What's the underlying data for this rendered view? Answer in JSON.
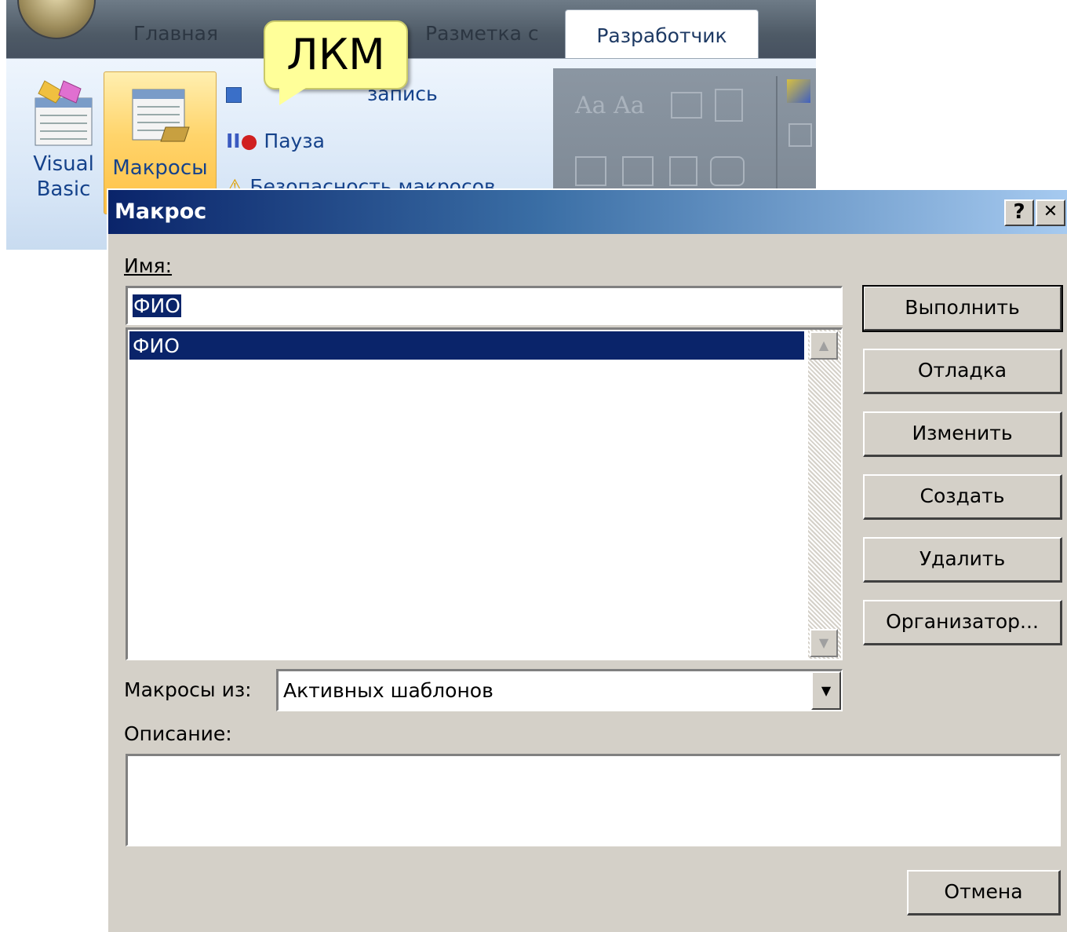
{
  "ribbon": {
    "tabs": [
      "Главная",
      "Разметка с"
    ],
    "active_tab": "Разработчик",
    "visual_basic": [
      "Visual",
      "Basic"
    ],
    "macros_label": "Макросы",
    "items": [
      "запись",
      "Пауза",
      "Безопасность макросов"
    ],
    "disabled_group_text": "Aa Aa"
  },
  "callout": {
    "text": "ЛКМ"
  },
  "dialog": {
    "title": "Макрос",
    "help_btn": "?",
    "close_btn": "✕",
    "name_label": "Имя:",
    "name_value": "ФИО",
    "list_items": [
      "ФИО"
    ],
    "macros_from_label": "Макросы из:",
    "macros_from_value": "Активных шаблонов",
    "description_label": "Описание:",
    "buttons": {
      "run": "Выполнить",
      "debug": "Отладка",
      "edit": "Изменить",
      "create": "Создать",
      "delete": "Удалить",
      "organizer": "Организатор...",
      "cancel": "Отмена"
    }
  }
}
